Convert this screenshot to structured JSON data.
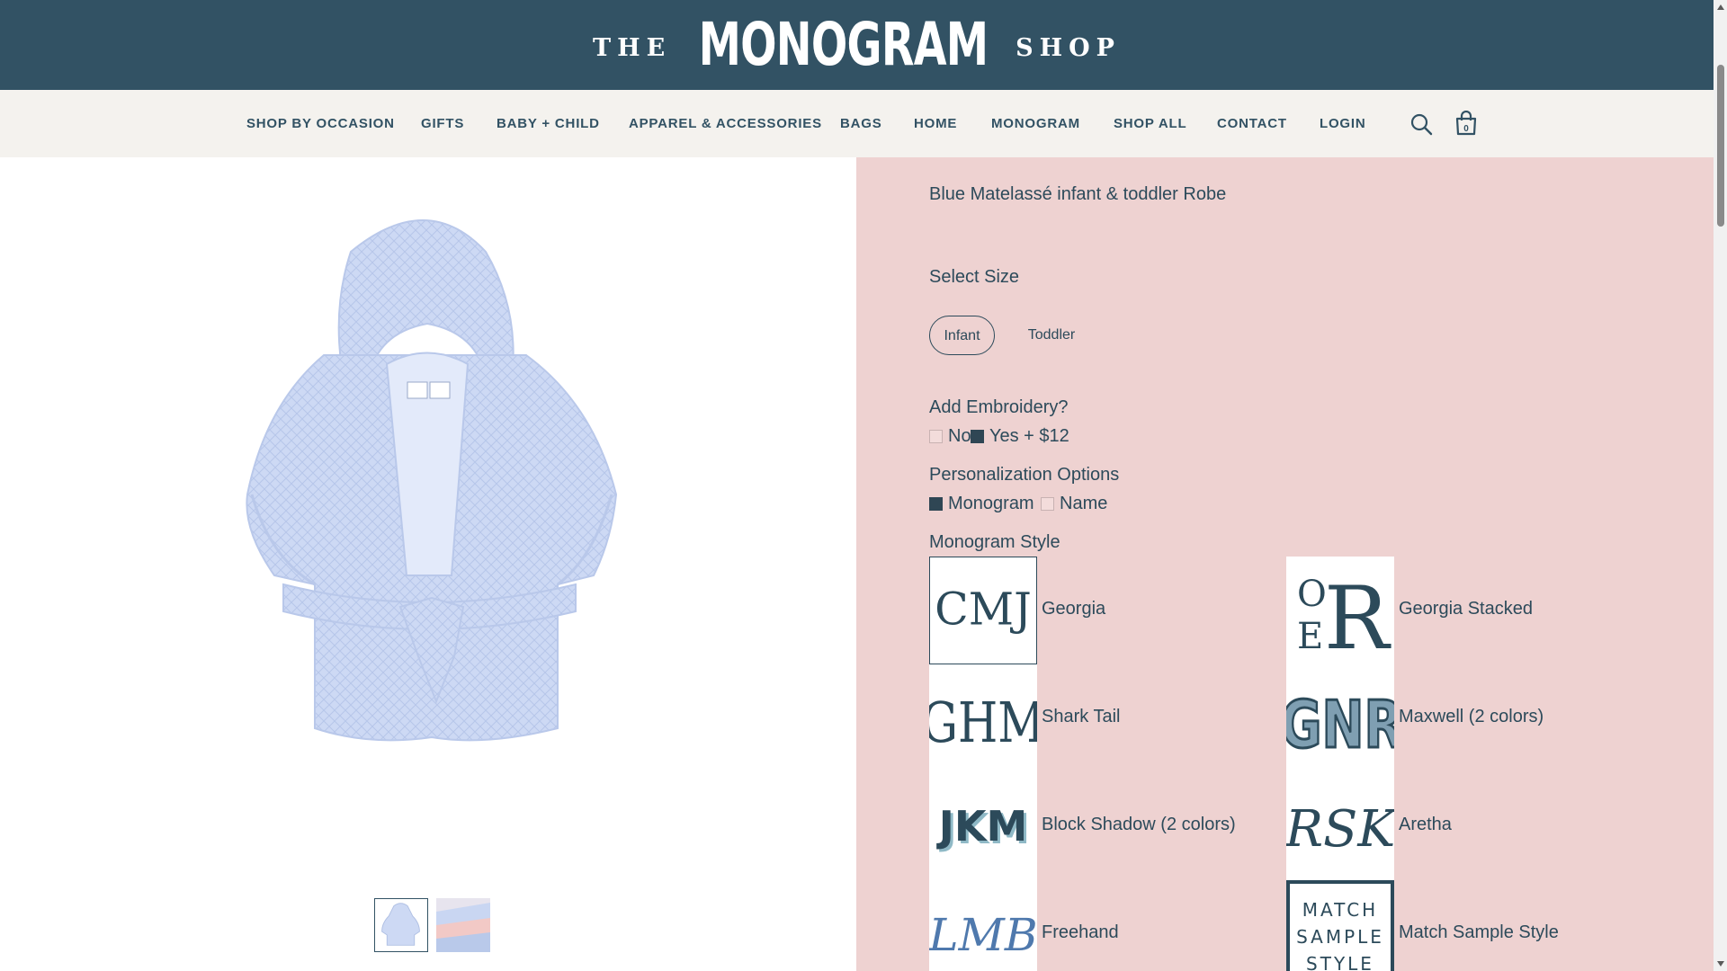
{
  "logo": {
    "the": "THE",
    "monogram": "MONOGRAM",
    "shop": "SHOP"
  },
  "nav": {
    "items": [
      "SHOP BY OCCASION",
      "GIFTS",
      "BABY + CHILD",
      "APPAREL & ACCESSORIES",
      "BAGS",
      "HOME",
      "MONOGRAM",
      "SHOP ALL",
      "CONTACT",
      "LOGIN"
    ],
    "cart_count": "0"
  },
  "product": {
    "title": "Blue Matelassé infant & toddler Robe",
    "size_label": "Select Size",
    "sizes": [
      "Infant",
      "Toddler"
    ],
    "selected_size": "Infant",
    "embroidery_label": "Add Embroidery?",
    "embroidery_options": [
      {
        "label": "No",
        "checked": false
      },
      {
        "label": "Yes + $12",
        "checked": true
      }
    ],
    "personalization_label": "Personalization Options",
    "personalization_options": [
      {
        "label": "Monogram",
        "checked": true
      },
      {
        "label": "Name",
        "checked": false
      }
    ],
    "monogram_style_label": "Monogram Style",
    "monogram_styles": [
      {
        "name": "Georgia",
        "sample": "CMJ",
        "selected": true
      },
      {
        "name": "Georgia Stacked",
        "sample": "OER",
        "selected": false
      },
      {
        "name": "Shark Tail",
        "sample": "GHM",
        "selected": false
      },
      {
        "name": "Maxwell (2 colors)",
        "sample": "GNR",
        "selected": false
      },
      {
        "name": "Block Shadow (2 colors)",
        "sample": "JKM",
        "selected": false
      },
      {
        "name": "Aretha",
        "sample": "RSK",
        "selected": false
      },
      {
        "name": "Freehand",
        "sample": "LMB",
        "selected": false
      },
      {
        "name": "Match Sample Style",
        "sample": "MATCH SAMPLE STYLE",
        "selected": false
      }
    ]
  },
  "colors": {
    "header_bg": "#325264",
    "nav_bg": "#f4f2ee",
    "panel_bg": "#eed2d1",
    "text": "#2c4a5a",
    "robe": "#c9d6f2"
  }
}
